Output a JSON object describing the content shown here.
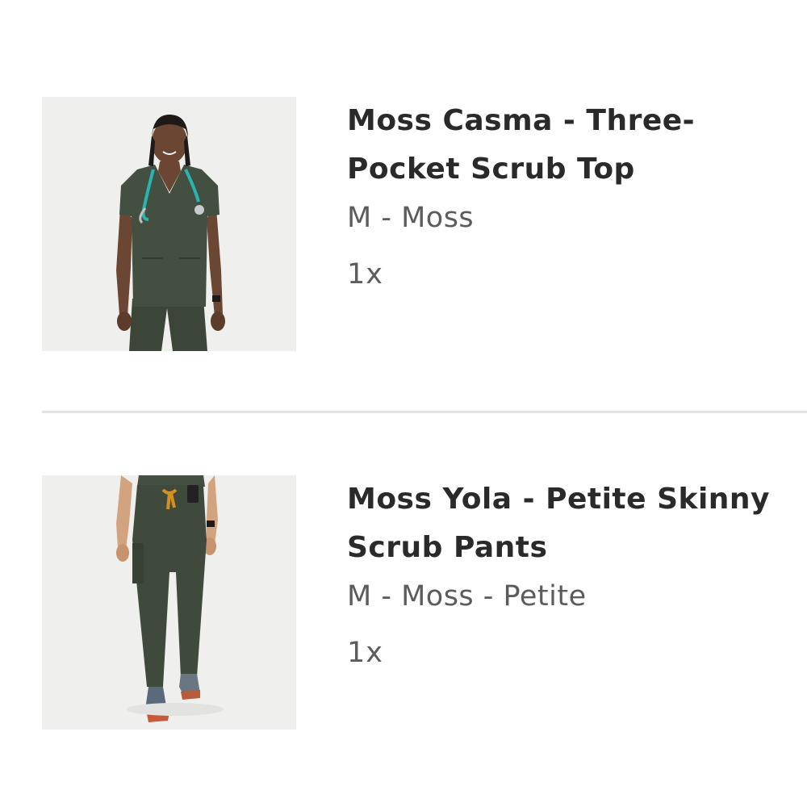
{
  "order": {
    "items": [
      {
        "title": "Moss Casma - Three-Pocket Scrub Top",
        "variant": "M - Moss",
        "quantity": "1x",
        "image_icon": "scrub-top-photo"
      },
      {
        "title": "Moss Yola - Petite Skinny Scrub Pants",
        "variant": "M - Moss - Petite",
        "quantity": "1x",
        "image_icon": "scrub-pants-photo"
      }
    ]
  },
  "colors": {
    "moss": "#3f4a3d",
    "background": "#ffffff",
    "divider": "#e3e3e3"
  }
}
